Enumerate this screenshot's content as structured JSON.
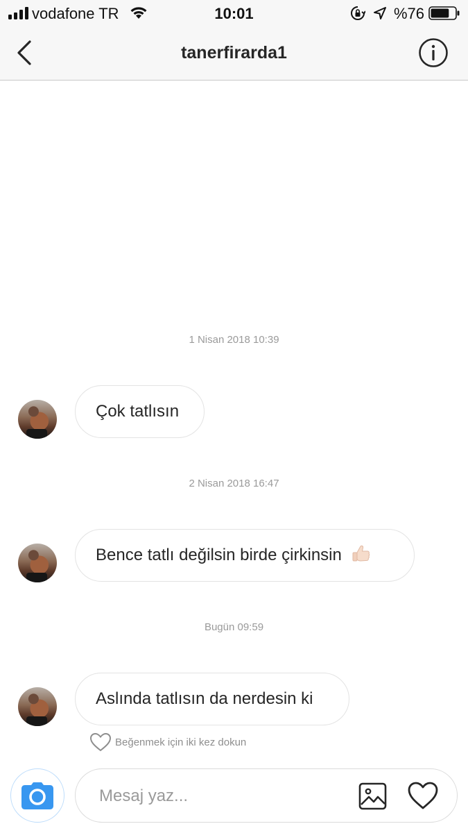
{
  "status_bar": {
    "carrier": "vodafone TR",
    "time": "10:01",
    "battery": "%76",
    "battery_level": 0.76,
    "icons": [
      "signal-icon",
      "wifi-icon",
      "rotation-lock-icon",
      "location-arrow-icon",
      "battery-icon"
    ]
  },
  "header": {
    "title": "tanerfirarda1",
    "icons": [
      "back-chevron-icon",
      "info-icon"
    ]
  },
  "messages": [
    {
      "timestamp": "1 Nisan 2018 10:39",
      "text": "Çok tatlısın"
    },
    {
      "timestamp": "2 Nisan 2018 16:47",
      "text": "Bence tatlı değilsin birde çirkinsin",
      "emoji": "thumbs-up-icon"
    },
    {
      "timestamp": "Bugün 09:59",
      "text": "Aslında tatlısın da nerdesin ki"
    }
  ],
  "like_hint": "Beğenmek için iki kez dokun",
  "composer": {
    "placeholder": "Mesaj yaz...",
    "icons": [
      "camera-icon",
      "gallery-icon",
      "heart-icon"
    ]
  },
  "colors": {
    "accent": "#3897f0",
    "bubble_border": "#e3e3e3",
    "timestamp": "#9a9a9a",
    "text": "#262626"
  }
}
